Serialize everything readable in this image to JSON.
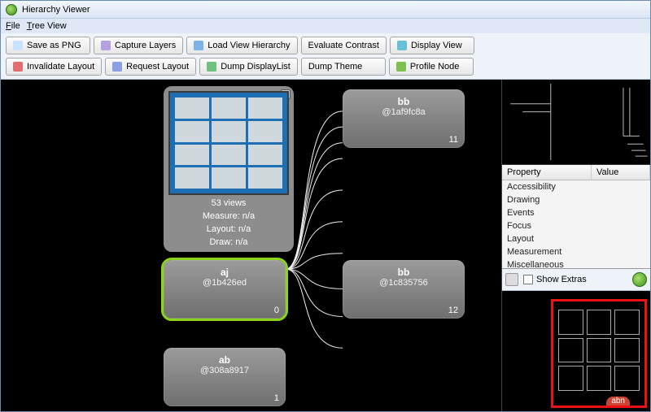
{
  "window": {
    "title": "Hierarchy Viewer"
  },
  "menu": {
    "file": "File",
    "treeview": "Tree View"
  },
  "toolbar": {
    "saveAsPng": "Save as PNG",
    "captureLayers": "Capture Layers",
    "loadViewHierarchy": "Load View Hierarchy",
    "evaluateContrast": "Evaluate Contrast",
    "displayView": "Display View",
    "invalidateLayout": "Invalidate Layout",
    "requestLayout": "Request Layout",
    "dumpDisplayList": "Dump DisplayList",
    "dumpTheme": "Dump Theme",
    "profileNode": "Profile Node"
  },
  "tooltip": {
    "views": "53 views",
    "measure": "Measure: n/a",
    "layout": "Layout: n/a",
    "draw": "Draw: n/a"
  },
  "nodes": {
    "bb1": {
      "title": "bb",
      "id": "@1af9fc8a",
      "num": "11"
    },
    "aj": {
      "title": "aj",
      "id": "@1b426ed",
      "num": "0"
    },
    "bb2": {
      "title": "bb",
      "id": "@1c835756",
      "num": "12"
    },
    "ab": {
      "title": "ab",
      "id": "@308a8917",
      "num": "1"
    }
  },
  "props": {
    "headProperty": "Property",
    "headValue": "Value",
    "rows": {
      "accessibility": "Accessibility",
      "drawing": "Drawing",
      "events": "Events",
      "focus": "Focus",
      "layout": "Layout",
      "measurement": "Measurement",
      "miscellaneous": "Miscellaneous"
    }
  },
  "extras": {
    "label": "Show Extras"
  },
  "preview": {
    "name": "abn"
  }
}
